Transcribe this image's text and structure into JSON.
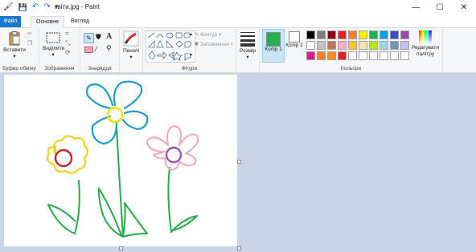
{
  "window": {
    "title": "квіти.jpg - Paint",
    "minimize": "—",
    "maximize": "☐",
    "close": "✕"
  },
  "quick_access": {
    "app_icon": "paint-icon",
    "save": "save-icon",
    "undo": "undo-icon",
    "redo": "redo-icon",
    "customize": "dropdown-icon"
  },
  "tabs": [
    "Файл",
    "Основне",
    "Вигляд"
  ],
  "ribbon": {
    "clipboard": {
      "paste_label": "Вставити",
      "group_label": "Буфер обміну"
    },
    "image": {
      "select_label": "Виділити",
      "group_label": "Зображення"
    },
    "tools": {
      "group_label": "Знаряддя"
    },
    "brushes": {
      "label": "Пензлі"
    },
    "shapes": {
      "outline_label": "Контур",
      "fill_label": "Заповнення",
      "group_label": "Фігури"
    },
    "size": {
      "label": "Розмір"
    },
    "colors": {
      "color1_label": "Колір 1",
      "color2_label": "Колір 2",
      "edit_label": "Редагувати палітру",
      "group_label": "Кольори",
      "color1": "#22b14c",
      "color2": "#ffffff",
      "palette_row1": [
        "#000000",
        "#7f7f7f",
        "#880015",
        "#ed1c24",
        "#ff7f27",
        "#fff200",
        "#22b14c",
        "#00a2e8",
        "#3f48cc",
        "#a349a4"
      ],
      "palette_row2": [
        "#ffffff",
        "#c3c3c3",
        "#b97a57",
        "#ffaec9",
        "#ffc90e",
        "#efe4b0",
        "#b5e61d",
        "#99d9ea",
        "#7092be",
        "#c8bfe7"
      ],
      "palette_row3": [
        "#e8158a",
        "#ff7f27",
        "#f28c28",
        "#ed1c24",
        "#ffffff",
        "#ffffff",
        "#ffffff",
        "#ffffff",
        "#ffffff",
        "#ffffff"
      ]
    }
  }
}
